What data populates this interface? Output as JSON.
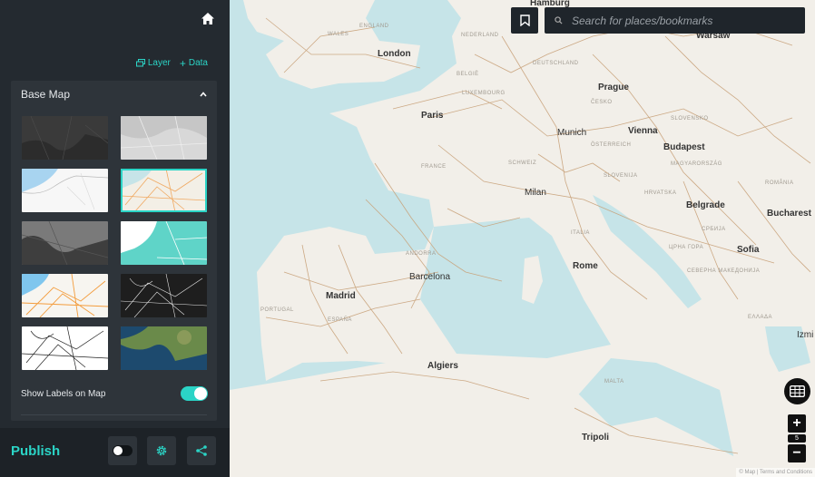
{
  "sidebar": {
    "home_icon": "home-icon",
    "actions": {
      "layer_label": "Layer",
      "data_label": "Data"
    },
    "base_map": {
      "title": "Base Map",
      "styles": [
        {
          "id": "dark"
        },
        {
          "id": "gray"
        },
        {
          "id": "light-blue"
        },
        {
          "id": "color-roads",
          "selected": true
        },
        {
          "id": "dark-gray"
        },
        {
          "id": "teal"
        },
        {
          "id": "orange-roads"
        },
        {
          "id": "black-lines"
        },
        {
          "id": "white-lines"
        },
        {
          "id": "satellite"
        }
      ],
      "show_labels_label": "Show Labels on Map",
      "show_labels_on": true
    },
    "footer": {
      "publish_label": "Publish"
    }
  },
  "map": {
    "search_placeholder": "Search for places/bookmarks",
    "zoom_level": "5",
    "attribution": "© Map | Terms and Conditions",
    "cities": [
      {
        "id": "hamburg",
        "name": "Hamburg"
      },
      {
        "id": "warsaw",
        "name": "Warsaw"
      },
      {
        "id": "london",
        "name": "London"
      },
      {
        "id": "prague",
        "name": "Prague"
      },
      {
        "id": "paris",
        "name": "Paris"
      },
      {
        "id": "munich",
        "name": "Munich"
      },
      {
        "id": "vienna",
        "name": "Vienna"
      },
      {
        "id": "budapest",
        "name": "Budapest"
      },
      {
        "id": "milan",
        "name": "Milan"
      },
      {
        "id": "belgrade",
        "name": "Belgrade"
      },
      {
        "id": "bucharest",
        "name": "Bucharest"
      },
      {
        "id": "sofia",
        "name": "Sofia"
      },
      {
        "id": "barcelona",
        "name": "Barcelona"
      },
      {
        "id": "rome",
        "name": "Rome"
      },
      {
        "id": "madrid",
        "name": "Madrid"
      },
      {
        "id": "izmir",
        "name": "Izmi"
      },
      {
        "id": "algiers",
        "name": "Algiers"
      },
      {
        "id": "tripoli",
        "name": "Tripoli"
      }
    ],
    "regions": [
      {
        "id": "wales",
        "name": "WALES"
      },
      {
        "id": "england",
        "name": "ENGLAND"
      },
      {
        "id": "nederland",
        "name": "NEDERLAND"
      },
      {
        "id": "deutschland",
        "name": "DEUTSCHLAND"
      },
      {
        "id": "belgie",
        "name": "BELGIË"
      },
      {
        "id": "luxembourg",
        "name": "LUXEMBOURG"
      },
      {
        "id": "cesko",
        "name": "ČESKO"
      },
      {
        "id": "slovensko",
        "name": "SLOVENSKO"
      },
      {
        "id": "osterreich",
        "name": "ÖSTERREICH"
      },
      {
        "id": "magyar",
        "name": "MAGYARORSZÁG"
      },
      {
        "id": "romania",
        "name": "ROMÂNIA"
      },
      {
        "id": "france",
        "name": "FRANCE"
      },
      {
        "id": "schweiz",
        "name": "SCHWEIZ"
      },
      {
        "id": "slovenija",
        "name": "SLOVENIJA"
      },
      {
        "id": "hrvatska",
        "name": "HRVATSKA"
      },
      {
        "id": "italia",
        "name": "ITALIA"
      },
      {
        "id": "andorra",
        "name": "ANDORRA"
      },
      {
        "id": "portugal",
        "name": "PORTUGAL"
      },
      {
        "id": "espana",
        "name": "ESPAÑA"
      },
      {
        "id": "crnagora",
        "name": "ЦРНА ГОРА"
      },
      {
        "id": "srbija",
        "name": "СРБИЈА"
      },
      {
        "id": "makedonija",
        "name": "СЕВЕРНА МАКЕДОНИЈА"
      },
      {
        "id": "ellada",
        "name": "ΕΛΛΑΔΑ"
      },
      {
        "id": "malta",
        "name": "MALTA"
      }
    ]
  },
  "colors": {
    "accent": "#2bd4c6",
    "sidebar_bg": "#242a30",
    "sea": "#c6e4e8",
    "land": "#f2efe9",
    "roads": "#c8a27a"
  }
}
